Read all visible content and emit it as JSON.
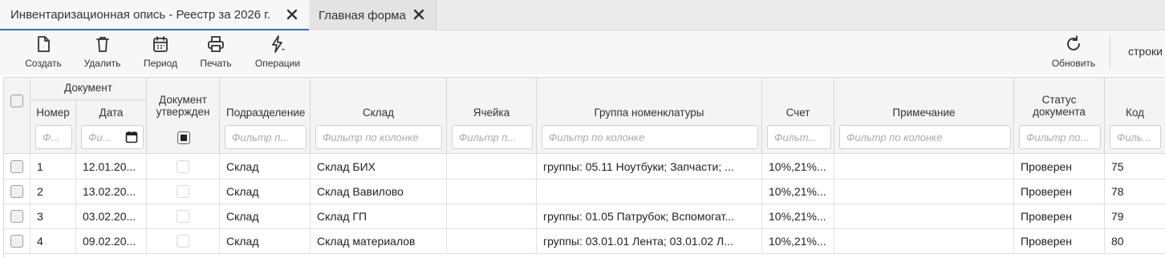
{
  "tabs": [
    {
      "label": "Инвентаризационная опись - Реестр за 2026 г.",
      "active": true
    },
    {
      "label": "Главная форма",
      "active": false
    }
  ],
  "toolbar": {
    "create": "Создать",
    "delete": "Удалить",
    "period": "Период",
    "print": "Печать",
    "operations": "Операции",
    "refresh": "Обновить",
    "rows": "строки"
  },
  "grid": {
    "group_document": "Документ",
    "columns": {
      "number": "Номер",
      "date": "Дата",
      "approved": "Документ утвержден",
      "division": "Подразделение",
      "warehouse": "Склад",
      "cell": "Ячейка",
      "group": "Группа номенклатуры",
      "account": "Счет",
      "note": "Примечание",
      "status": "Статус документа",
      "code": "Код"
    },
    "filters": {
      "number": "Ф...",
      "date": "Фи...",
      "division": "Фильтр п...",
      "warehouse": "Фильтр по колонке",
      "cell": "Фильтр п...",
      "group": "Фильтр по колонке",
      "account": "Фильт...",
      "note": "Фильтр по колонке",
      "status": "Фильтр по...",
      "code": "Филь..."
    },
    "rows": [
      {
        "number": "1",
        "date": "12.01.20...",
        "division": "Склад",
        "warehouse": "Склад БИХ",
        "cell": "",
        "group": "группы: 05.11 Ноутбуки; Запчасти; ...",
        "account": "10%,21%...",
        "note": "",
        "status": "Проверен",
        "code": "75"
      },
      {
        "number": "2",
        "date": "13.02.20...",
        "division": "Склад",
        "warehouse": "Склад Вавилово",
        "cell": "",
        "group": "",
        "account": "10%,21%...",
        "note": "",
        "status": "Проверен",
        "code": "78"
      },
      {
        "number": "3",
        "date": "03.02.20...",
        "division": "Склад",
        "warehouse": "Склад ГП",
        "cell": "",
        "group": "группы: 01.05 Патрубок; Вспомогат...",
        "account": "10%,21%...",
        "note": "",
        "status": "Проверен",
        "code": "79"
      },
      {
        "number": "4",
        "date": "09.02.20...",
        "division": "Склад",
        "warehouse": "Склад материалов",
        "cell": "",
        "group": "группы: 03.01.01 Лента; 03.01.02 Л...",
        "account": "10%,21%...",
        "note": "",
        "status": "Проверен",
        "code": "80"
      }
    ]
  },
  "colors": {
    "accent": "#2d6ec9",
    "header_bg": "#f4f4f4",
    "tabbar_bg": "#ebebeb"
  }
}
